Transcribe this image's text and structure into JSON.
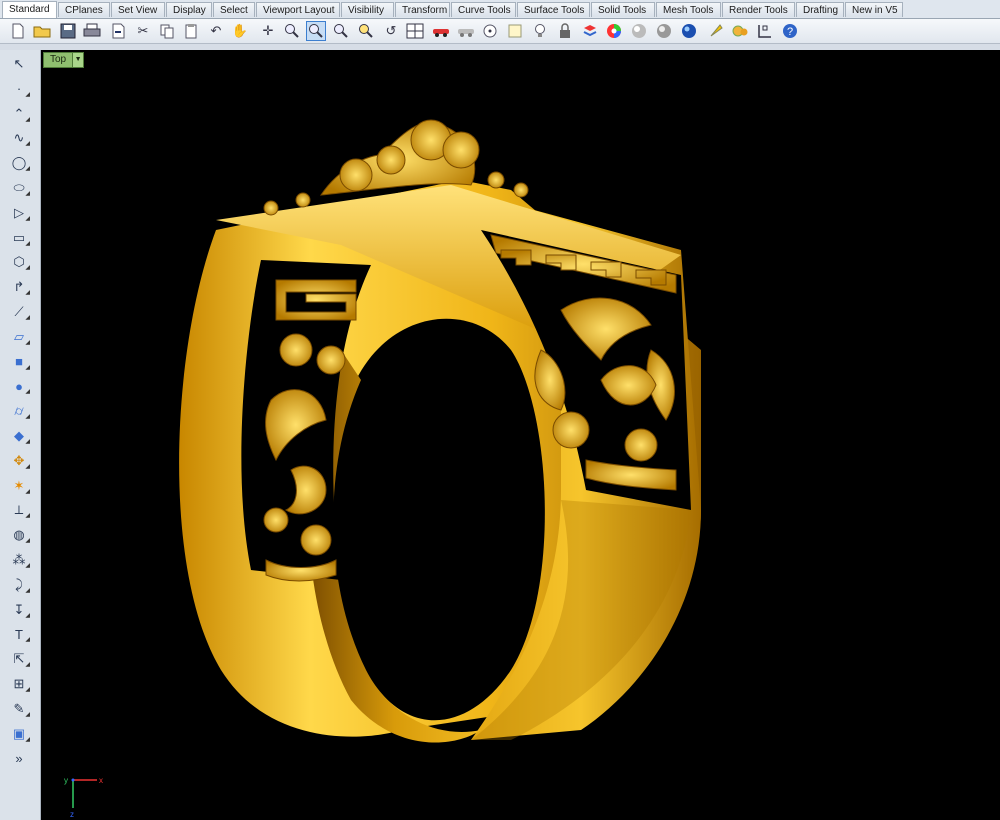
{
  "tabs": [
    "Standard",
    "CPlanes",
    "Set View",
    "Display",
    "Select",
    "Viewport Layout",
    "Visibility",
    "Transform",
    "Curve Tools",
    "Surface Tools",
    "Solid Tools",
    "Mesh Tools",
    "Render Tools",
    "Drafting",
    "New in V5"
  ],
  "toolbar_icons": [
    "new-file-icon",
    "open-folder-icon",
    "save-icon",
    "print-icon",
    "import-icon",
    "cut-icon",
    "copy-icon",
    "paste-icon",
    "undo-icon",
    "pan-hand-icon",
    "rotate-view-icon",
    "zoom-icon",
    "zoom-window-icon",
    "zoom-extents-icon",
    "zoom-selected-icon",
    "undo-view-icon",
    "four-viewports-icon",
    "car-icon",
    "toggle-visibility-icon",
    "points-on-icon",
    "select-filter-icon",
    "lightbulb-icon",
    "lock-icon",
    "layer-icon",
    "color-wheel-icon",
    "render-sphere-icon",
    "material-sphere-icon",
    "spotlight-icon",
    "settings-gear-icon",
    "grid-snap-icon",
    "help-icon"
  ],
  "left_tools": [
    "select-arrow-icon",
    "point-icon",
    "polyline-icon",
    "curve-control-icon",
    "circle-icon",
    "ellipse-icon",
    "polygon-triangle-icon",
    "rectangle-icon",
    "polygon-icon",
    "fillet-curve-icon",
    "offset-curve-icon",
    "surface-icon",
    "box-solid-icon",
    "sphere-solid-icon",
    "cylinder-solid-icon",
    "planar-surface-icon",
    "boolean-icon",
    "explode-icon",
    "split-icon",
    "mesh-icon",
    "points-cloud-icon",
    "curve-from-object-icon",
    "dimension-icon",
    "text-icon",
    "transform-icon",
    "array-icon",
    "analyze-icon",
    "render-box-icon",
    "more-tools-icon"
  ],
  "viewport": {
    "title": "Top"
  },
  "axis": {
    "x": "x",
    "y": "y",
    "z": "z"
  },
  "colors": {
    "gold_light": "#ffd84a",
    "gold_mid": "#e8a80a",
    "gold_dark": "#8a5a00",
    "background": "#000000"
  }
}
